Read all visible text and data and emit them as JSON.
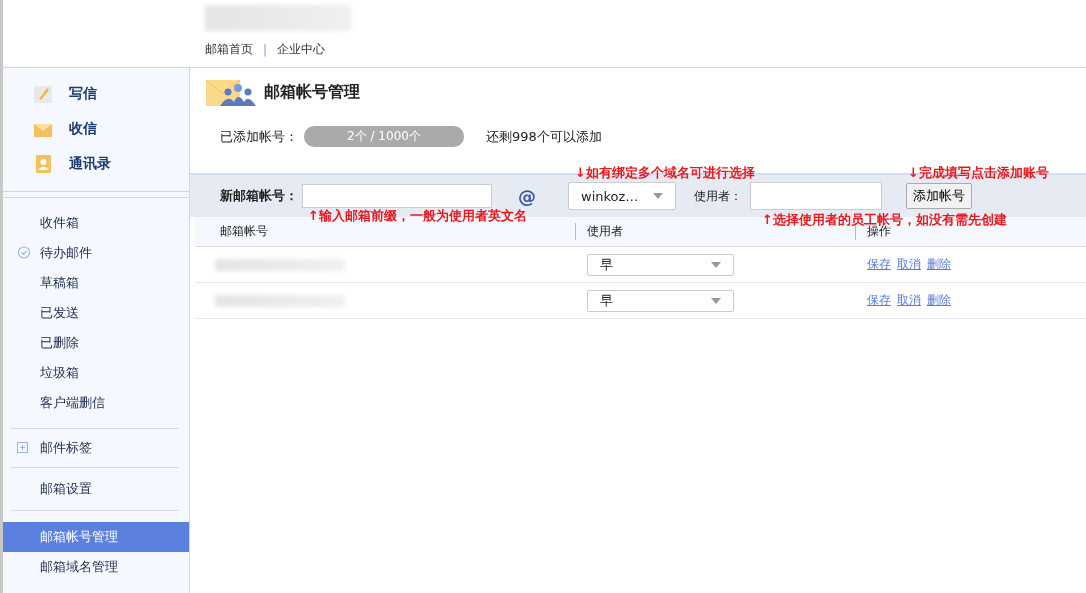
{
  "header": {
    "links": [
      "邮箱首页",
      "企业中心"
    ],
    "separator": "|"
  },
  "sidebar": {
    "quick": [
      {
        "kind": "compose",
        "label": "写信"
      },
      {
        "kind": "inbox",
        "label": "收信"
      },
      {
        "kind": "contacts",
        "label": "通讯录"
      }
    ],
    "folders": [
      {
        "label": "收件箱",
        "kind": "plain"
      },
      {
        "label": "待办邮件",
        "kind": "todo"
      },
      {
        "label": "草稿箱",
        "kind": "plain"
      },
      {
        "label": "已发送",
        "kind": "plain"
      },
      {
        "label": "已删除",
        "kind": "plain"
      },
      {
        "label": "垃圾箱",
        "kind": "plain"
      },
      {
        "label": "客户端删信",
        "kind": "plain"
      }
    ],
    "tags": {
      "label": "邮件标签",
      "expanded": false
    },
    "settings": [
      {
        "label": "邮箱设置",
        "selected": false
      }
    ],
    "admin": [
      {
        "label": "邮箱帐号管理",
        "selected": true
      },
      {
        "label": "邮箱域名管理",
        "selected": false
      }
    ]
  },
  "page": {
    "title": "邮箱帐号管理",
    "added_label": "已添加帐号：",
    "added_count": "2个 / 1000个",
    "remaining": "还剩998个可以添加"
  },
  "form": {
    "account_label": "新邮箱帐号：",
    "at": "@",
    "domain": "winkoz…",
    "user_label": "使用者：",
    "add_button": "添加帐号",
    "annotations": [
      "↓如有绑定多个域名可进行选择",
      "↓完成填写点击添加账号",
      "↑输入邮箱前缀，一般为使用者英文名",
      "↑选择使用者的员工帐号，如没有需先创建"
    ]
  },
  "table": {
    "columns": [
      "邮箱帐号",
      "使用者",
      "操作"
    ],
    "rows": [
      {
        "user": "早",
        "actions": [
          "保存",
          "取消",
          "删除"
        ]
      },
      {
        "user": "早",
        "actions": [
          "保存",
          "取消",
          "删除"
        ]
      }
    ]
  }
}
